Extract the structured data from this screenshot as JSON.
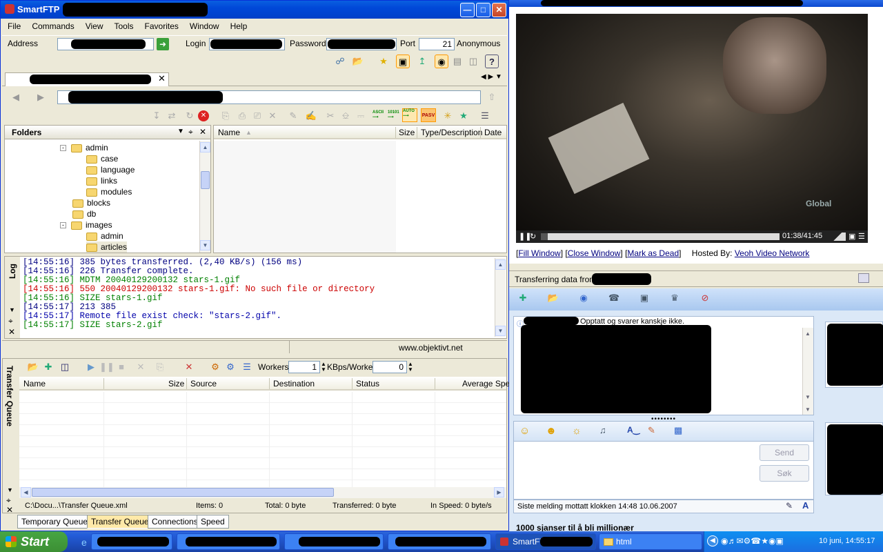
{
  "ftp": {
    "title": "SmartFTP",
    "menu": [
      "File",
      "Commands",
      "View",
      "Tools",
      "Favorites",
      "Window",
      "Help"
    ],
    "address_label": "Address",
    "login_label": "Login",
    "password_label": "Password",
    "port_label": "Port",
    "port_value": "21",
    "anonymous_label": "Anonymous",
    "folders_title": "Folders",
    "tree": [
      {
        "label": "admin",
        "level": 0,
        "expanded": true
      },
      {
        "label": "case",
        "level": 1
      },
      {
        "label": "language",
        "level": 1
      },
      {
        "label": "links",
        "level": 1
      },
      {
        "label": "modules",
        "level": 1
      },
      {
        "label": "blocks",
        "level": 0
      },
      {
        "label": "db",
        "level": 0
      },
      {
        "label": "images",
        "level": 0,
        "expanded": true
      },
      {
        "label": "admin",
        "level": 1
      },
      {
        "label": "articles",
        "level": 1
      }
    ],
    "file_columns": [
      "Name",
      "Size",
      "Type/Description",
      "Date"
    ],
    "log_title": "Log",
    "log_lines": [
      {
        "text": "[14:55:16] 385 bytes transferred. (2,40 KB/s) (156 ms)",
        "color": "navy"
      },
      {
        "text": "[14:55:16] 226 Transfer complete.",
        "color": "navy"
      },
      {
        "text": "[14:55:16] MDTM 20040129200132 stars-1.gif",
        "color": "green"
      },
      {
        "text": "[14:55:16] 550 20040129200132 stars-1.gif: No such file or directory",
        "color": "red"
      },
      {
        "text": "[14:55:16] SIZE stars-1.gif",
        "color": "green"
      },
      {
        "text": "[14:55:17] 213 385",
        "color": "navy"
      },
      {
        "text": "[14:55:17] Remote file exist check: \"stars-2.gif\".",
        "color": "dblue"
      },
      {
        "text": "[14:55:17] SIZE stars-2.gif",
        "color": "green"
      }
    ],
    "status_url": "www.objektivt.net",
    "queue_title": "Transfer Queue",
    "workers_label": "Workers",
    "workers_value": "1",
    "kbps_label": "KBps/Worker",
    "kbps_value": "0",
    "queue_columns": [
      "Name",
      "Size",
      "Source",
      "Destination",
      "Status",
      "Average Spee"
    ],
    "queue_status": {
      "file": "C:\\Docu...\\Transfer Queue.xml",
      "items": "Items: 0",
      "total": "Total: 0 byte",
      "transferred": "Transferred: 0 byte",
      "speed": "In Speed: 0 byte/s"
    },
    "tabs": [
      "Temporary Queue",
      "Transfer Queue",
      "Connections",
      "Speed"
    ],
    "pasv": "PASV"
  },
  "video": {
    "time": "01:38/41:45",
    "watermark": "Global",
    "progress": 0.03,
    "links": [
      "Fill Window",
      "Close Window",
      "Mark as Dead"
    ],
    "hosted_by": "Hosted By:",
    "host_link": "Veoh Video Network",
    "transferring": "Transferring data from"
  },
  "chat": {
    "status_msg": "Opptatt og svarer kanskje ikke.",
    "send": "Send",
    "search": "Søk",
    "last_msg": "Siste melding mottatt klokken 14:48 10.06.2007",
    "ad": "1000 sjanser til å bli millionær"
  },
  "taskbar": {
    "start": "Start",
    "tasks": [
      "SmartFT",
      "html"
    ],
    "clock": "10 juni, 14:55:17"
  }
}
